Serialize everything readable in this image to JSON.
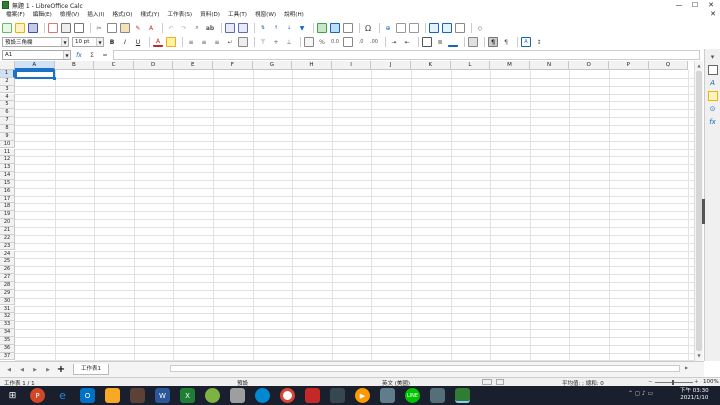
{
  "window": {
    "title": "無題 1 - LibreOffice Calc",
    "minimize": "—",
    "maximize": "☐",
    "close": "✕"
  },
  "menu": [
    "檔案(F)",
    "編輯(E)",
    "檢視(V)",
    "插入(I)",
    "格式(O)",
    "樣式(Y)",
    "工作表(S)",
    "資料(D)",
    "工具(T)",
    "視窗(W)",
    "說明(H)"
  ],
  "menu_close_doc": "✕",
  "format": {
    "style": "預設三角欄",
    "font_size": "10 pt",
    "bold": "B",
    "italic": "I",
    "underline": "U"
  },
  "formula": {
    "cell_ref": "A1",
    "fx": "fx",
    "sigma": "Σ",
    "equals": "=",
    "value": ""
  },
  "columns": [
    "A",
    "B",
    "C",
    "D",
    "E",
    "F",
    "G",
    "H",
    "I",
    "J",
    "K",
    "L",
    "M",
    "N",
    "O",
    "P",
    "Q"
  ],
  "rows": [
    "1",
    "2",
    "3",
    "4",
    "5",
    "6",
    "7",
    "8",
    "9",
    "10",
    "11",
    "12",
    "13",
    "14",
    "15",
    "16",
    "17",
    "18",
    "19",
    "20",
    "21",
    "22",
    "23",
    "24",
    "25",
    "26",
    "27",
    "28",
    "29",
    "30",
    "31",
    "32",
    "33",
    "34",
    "35",
    "36",
    "37"
  ],
  "sheet_tab": "工作表1",
  "status": {
    "sheet": "工作表 1 / 1",
    "page_style": "預設",
    "language": "英文 (美國)",
    "selection_stats": "平均值: ; 總和: 0",
    "zoom": "100%"
  },
  "clock": {
    "time": "下午 03:30",
    "date": "2021/1/10"
  },
  "colors": {
    "selection": "#1a73c8",
    "excel": "#1e7e34",
    "calc": "#2e7d32"
  }
}
